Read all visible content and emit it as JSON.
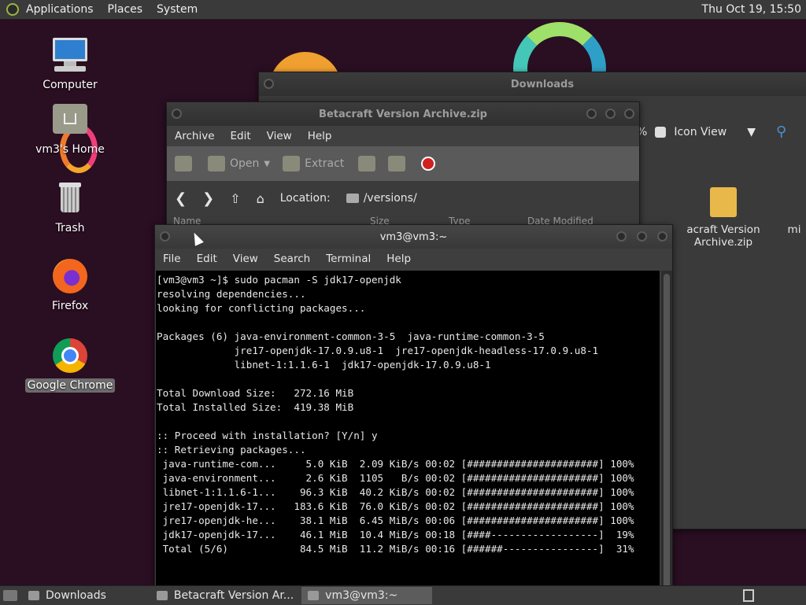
{
  "top_panel": {
    "menus": [
      "Applications",
      "Places",
      "System"
    ],
    "clock": "Thu Oct 19, 15:50"
  },
  "desktop": {
    "icons": [
      {
        "label": "Computer",
        "icon": "computer-icon"
      },
      {
        "label": "vm3's Home",
        "icon": "home-folder-icon"
      },
      {
        "label": "Trash",
        "icon": "trash-icon"
      },
      {
        "label": "Firefox",
        "icon": "firefox-icon"
      },
      {
        "label": "Google Chrome",
        "icon": "chrome-icon",
        "selected": true
      }
    ]
  },
  "downloads_window": {
    "title": "Downloads",
    "zoom_suffix": "%",
    "view_mode": "Icon View",
    "files": [
      {
        "name": "acraft Version\nArchive.zip"
      },
      {
        "name": "mi"
      }
    ]
  },
  "archive_window": {
    "title": "Betacraft Version Archive.zip",
    "menus": [
      "Archive",
      "Edit",
      "View",
      "Help"
    ],
    "toolbar": {
      "open": "Open",
      "extract": "Extract"
    },
    "location_label": "Location:",
    "location_value": "/versions/",
    "columns": [
      "Name",
      "Size",
      "Type",
      "Date Modified"
    ]
  },
  "terminal_window": {
    "title": "vm3@vm3:~",
    "menus": [
      "File",
      "Edit",
      "View",
      "Search",
      "Terminal",
      "Help"
    ],
    "output": "[vm3@vm3 ~]$ sudo pacman -S jdk17-openjdk\nresolving dependencies...\nlooking for conflicting packages...\n\nPackages (6) java-environment-common-3-5  java-runtime-common-3-5\n             jre17-openjdk-17.0.9.u8-1  jre17-openjdk-headless-17.0.9.u8-1\n             libnet-1:1.1.6-1  jdk17-openjdk-17.0.9.u8-1\n\nTotal Download Size:   272.16 MiB\nTotal Installed Size:  419.38 MiB\n\n:: Proceed with installation? [Y/n] y\n:: Retrieving packages...\n java-runtime-com...     5.0 KiB  2.09 KiB/s 00:02 [######################] 100%\n java-environment...     2.6 KiB  1105   B/s 00:02 [######################] 100%\n libnet-1:1.1.6-1...    96.3 KiB  40.2 KiB/s 00:02 [######################] 100%\n jre17-openjdk-17...   183.6 KiB  76.0 KiB/s 00:02 [######################] 100%\n jre17-openjdk-he...    38.1 MiB  6.45 MiB/s 00:06 [######################] 100%\n jdk17-openjdk-17...    46.1 MiB  10.4 MiB/s 00:18 [####------------------]  19%\n Total (5/6)            84.5 MiB  11.2 MiB/s 00:16 [######----------------]  31%"
  },
  "taskbar": {
    "items": [
      {
        "label": "Downloads",
        "active": false
      },
      {
        "label": "Betacraft Version Ar...",
        "active": false
      },
      {
        "label": "vm3@vm3:~",
        "active": true
      }
    ]
  }
}
